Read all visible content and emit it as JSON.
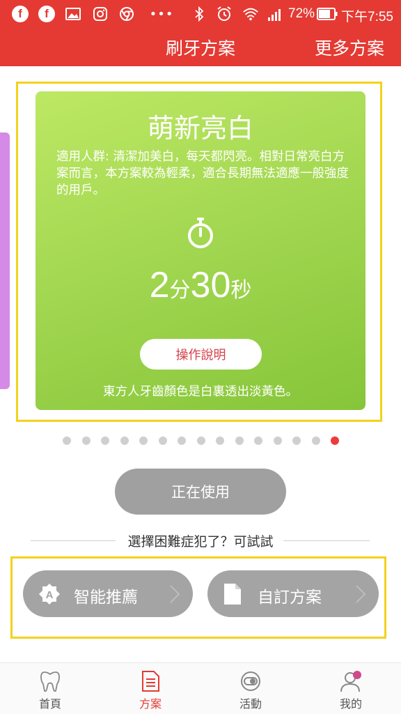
{
  "status_bar": {
    "battery": "72%",
    "time": "下午7:55",
    "icons": [
      "facebook-icon",
      "facebook-icon",
      "image-icon",
      "instagram-icon",
      "chrome-icon",
      "more-dots-icon",
      "bluetooth-icon",
      "alarm-icon",
      "wifi-icon",
      "signal-icon",
      "battery-icon"
    ]
  },
  "header": {
    "title": "刷牙方案",
    "more": "更多方案"
  },
  "plan_card": {
    "title": "萌新亮白",
    "description": "適用人群: 清潔加美白，每天都閃亮。相對日常亮白方案而言，本方案較為輕柔，適合長期無法適應一般強度的用戶。",
    "duration_minutes": "2",
    "minutes_unit": "分",
    "duration_seconds": "30",
    "seconds_unit": "秒",
    "help_label": "操作說明",
    "note": "東方人牙齒顏色是白裏透出淡黃色。",
    "color": "#a4d852",
    "icon": "stopwatch-icon"
  },
  "pager": {
    "count": 15,
    "active_index": 14,
    "active_color": "#ef3a3a"
  },
  "using_button": "正在使用",
  "hint": "選擇困難症犯了？可試試",
  "options": [
    {
      "label": "智能推薦",
      "icon": "smart-badge-icon"
    },
    {
      "label": "自訂方案",
      "icon": "document-icon"
    }
  ],
  "tabs": [
    {
      "label": "首頁",
      "icon": "tooth-icon",
      "active": false
    },
    {
      "label": "方案",
      "icon": "plan-doc-icon",
      "active": true
    },
    {
      "label": "活動",
      "icon": "toggle-icon",
      "active": false
    },
    {
      "label": "我的",
      "icon": "user-icon",
      "active": false
    }
  ],
  "accent_color": "#e43a33"
}
